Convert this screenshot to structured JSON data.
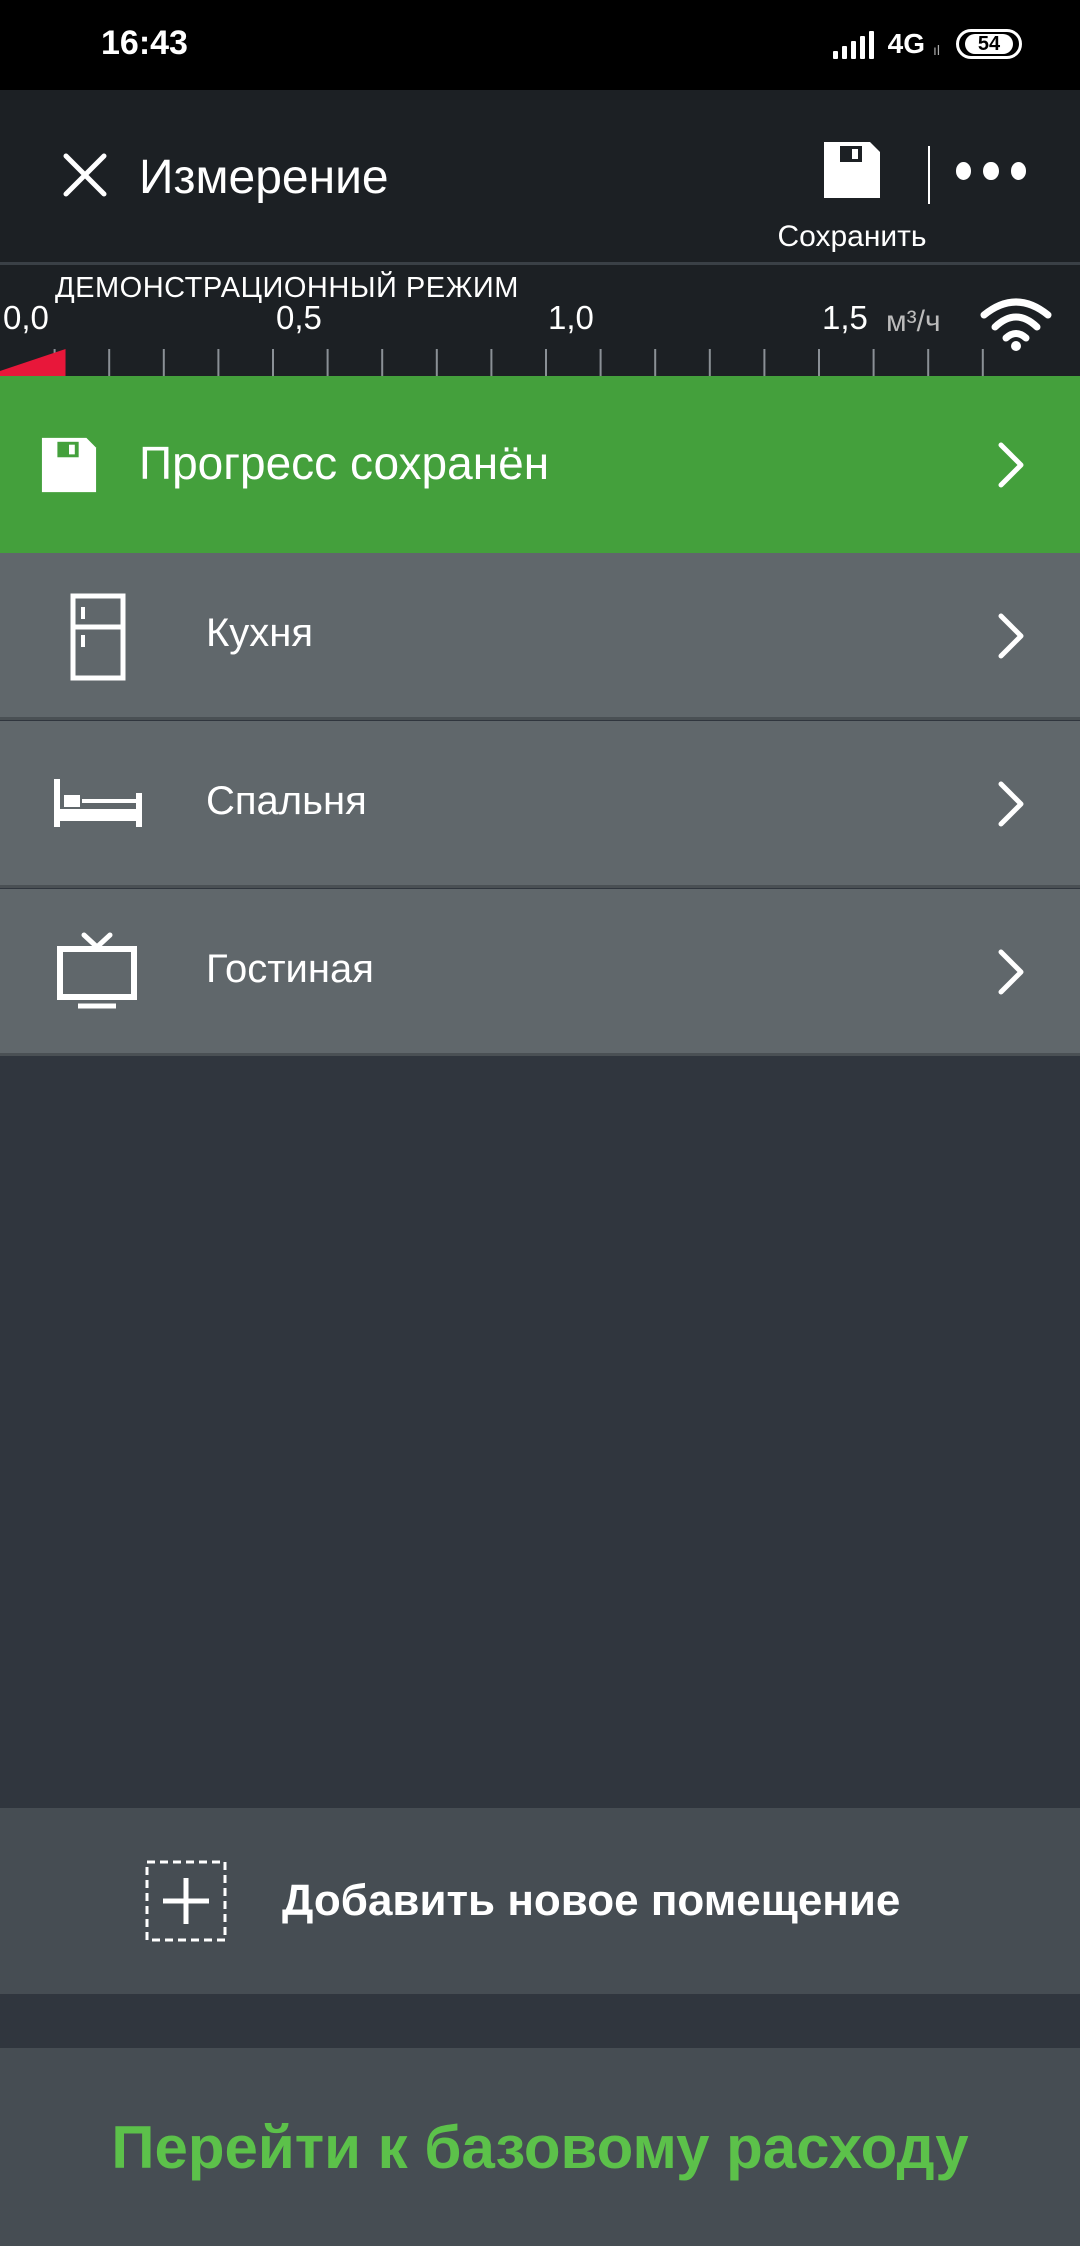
{
  "status_bar": {
    "time": "16:43",
    "network": "4G",
    "network_sub": "ıl",
    "battery": "54"
  },
  "header": {
    "title": "Измерение",
    "save_label": "Сохранить",
    "close_icon": "close-icon",
    "save_icon": "floppy-disk-icon",
    "more_icon": "more-horizontal-icon"
  },
  "meter": {
    "mode_label": "ДЕМОНСТРАЦИОННЫЙ РЕЖИМ",
    "tick_labels": [
      "0,0",
      "0,5",
      "1,0",
      "1,5"
    ],
    "unit": "м³/ч",
    "current_value": 0.12,
    "scale_max": 1.8,
    "indicator_color": "#e8173a",
    "wifi_icon": "wifi-icon"
  },
  "progress_banner": {
    "text": "Прогресс сохранён",
    "icon": "floppy-disk-icon",
    "color": "#44a03c"
  },
  "rooms": [
    {
      "label": "Кухня",
      "icon": "fridge-icon"
    },
    {
      "label": "Спальня",
      "icon": "bed-icon"
    },
    {
      "label": "Гостиная",
      "icon": "tv-icon"
    }
  ],
  "add_room": {
    "label": "Добавить новое помещение",
    "icon": "add-square-icon"
  },
  "cta": {
    "label": "Перейти к базовому расходу",
    "color": "#5cc14a"
  }
}
